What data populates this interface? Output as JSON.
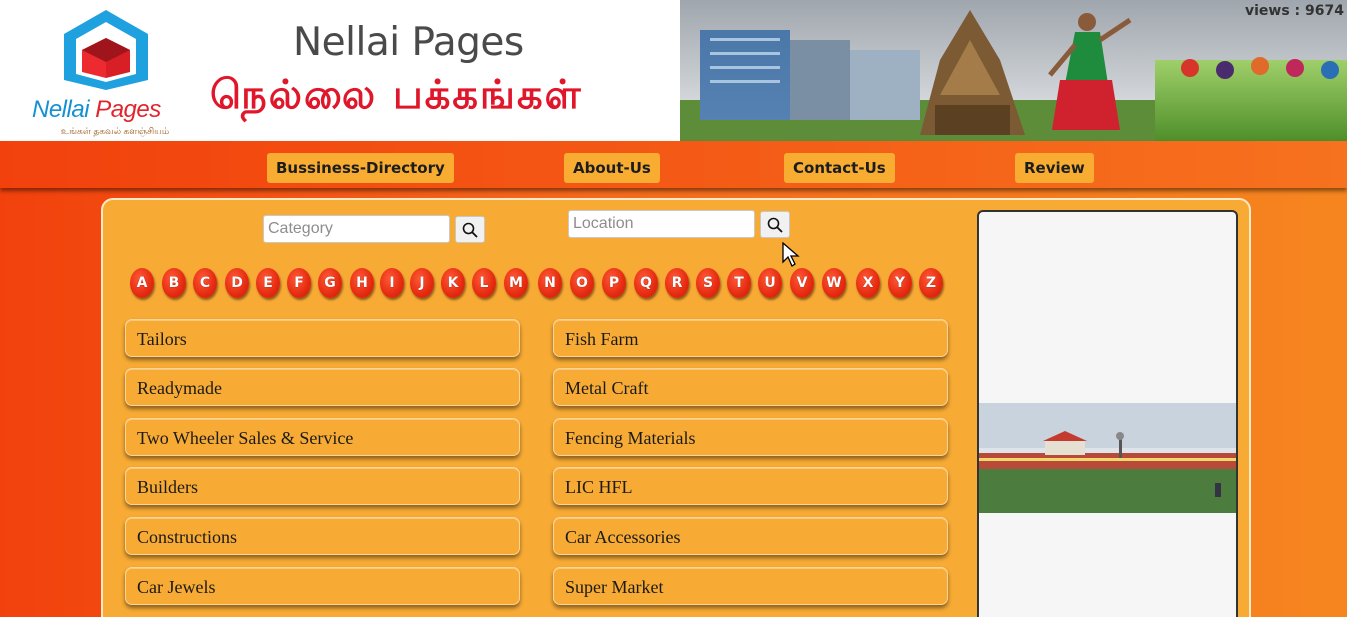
{
  "header": {
    "logo_brand": "Nellai",
    "logo_brand_accent": "Pages",
    "logo_tagline": "உங்கள் தகவல் களஞ்சியம்",
    "title_en": "Nellai Pages",
    "title_ta": "நெல்லை  பக்கங்கள்",
    "views": "views : 9674"
  },
  "nav": {
    "items": [
      {
        "label": "Bussiness-Directory"
      },
      {
        "label": "About-Us"
      },
      {
        "label": "Contact-Us"
      },
      {
        "label": "Review"
      }
    ]
  },
  "search": {
    "category_placeholder": "Category",
    "category_value": "",
    "location_placeholder": "Location",
    "location_value": "",
    "button_icon": "search-icon"
  },
  "alphabet": [
    "A",
    "B",
    "C",
    "D",
    "E",
    "F",
    "G",
    "H",
    "I",
    "J",
    "K",
    "L",
    "M",
    "N",
    "O",
    "P",
    "Q",
    "R",
    "S",
    "T",
    "U",
    "V",
    "W",
    "X",
    "Y",
    "Z"
  ],
  "categories": {
    "left": [
      "Tailors",
      "Readymade",
      "Two Wheeler Sales & Service",
      "Builders",
      "Constructions",
      "Car Jewels"
    ],
    "right": [
      "Fish Farm",
      "Metal Craft",
      "Fencing Materials",
      "LIC HFL",
      "Car Accessories",
      "Super Market"
    ]
  },
  "colors": {
    "nav_gradient_start": "#f2410d",
    "nav_gradient_end": "#f6851f",
    "button_bg": "#f8ab34",
    "letter_red": "#e52a10",
    "brand_red": "#e0172a",
    "brand_blue": "#1591d2"
  }
}
